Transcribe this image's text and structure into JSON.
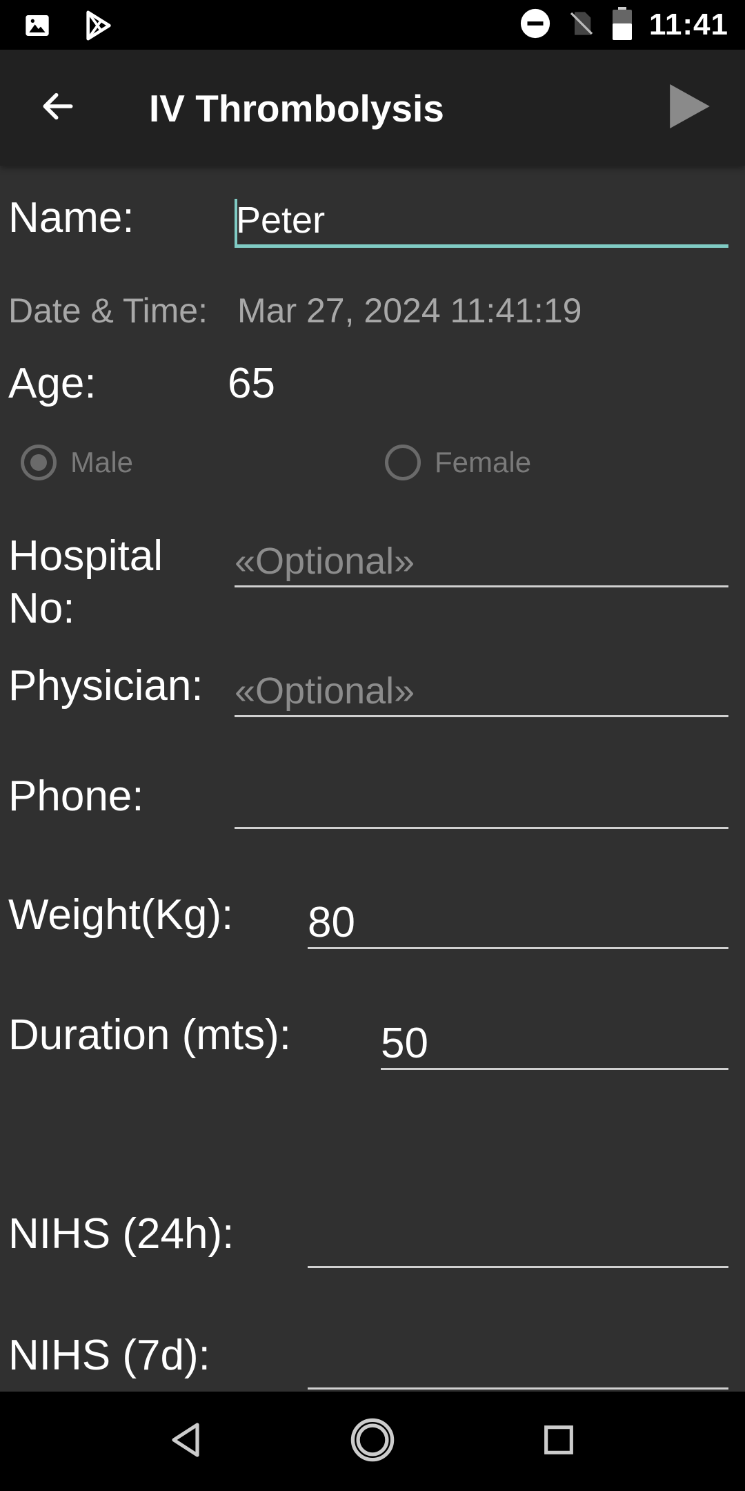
{
  "status_bar": {
    "time": "11:41",
    "left_icons": [
      "image-icon",
      "play-store-icon"
    ],
    "right_icons": [
      "do-not-disturb-icon",
      "no-sim-icon",
      "battery-icon"
    ]
  },
  "app_bar": {
    "title": "IV Thrombolysis",
    "back_icon": "arrow-left-icon",
    "action_icon": "play-icon"
  },
  "form": {
    "name": {
      "label": "Name:",
      "value": "Peter"
    },
    "datetime": {
      "label": "Date & Time:",
      "value": "Mar 27, 2024 11:41:19"
    },
    "age": {
      "label": "Age:",
      "value": "65"
    },
    "sex": {
      "options": [
        {
          "label": "Male",
          "selected": true
        },
        {
          "label": "Female",
          "selected": false
        }
      ]
    },
    "hospital_no": {
      "label_line1": "Hospital",
      "label_line2": "No:",
      "placeholder": "«Optional»"
    },
    "physician": {
      "label": "Physician:",
      "placeholder": "«Optional»"
    },
    "phone": {
      "label": "Phone:",
      "value": ""
    },
    "weight": {
      "label": "Weight(Kg):",
      "value": "80"
    },
    "duration": {
      "label": "Duration (mts):",
      "value": "50"
    },
    "nihs_24h": {
      "label": "NIHS (24h):",
      "value": ""
    },
    "nihs_7d": {
      "label": "NIHS (7d):",
      "value": ""
    }
  },
  "colors": {
    "background": "#303030",
    "app_bar": "#212121",
    "accent": "#80cbc4",
    "placeholder": "#8c8c8c"
  },
  "nav_bar": {
    "icons": [
      "nav-back-icon",
      "nav-home-icon",
      "nav-recents-icon"
    ]
  }
}
